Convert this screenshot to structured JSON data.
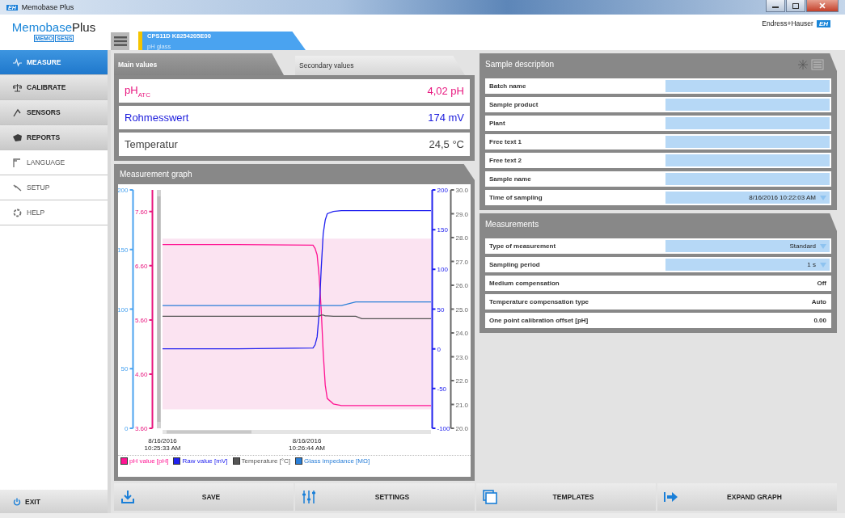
{
  "window": {
    "title": "Memobase Plus",
    "app_icon": "EH"
  },
  "header": {
    "logo_main": "Memobase",
    "logo_accent": "Plus",
    "logo_sub_left": "MEMO",
    "logo_sub_right": "SENS",
    "brand": "Endress+Hauser",
    "brand_mark": "EH",
    "sensor": {
      "name": "CPS11D K8254205E00",
      "type": "pH glass"
    }
  },
  "sidebar": {
    "items": [
      {
        "label": "MEASURE",
        "kind": "primary",
        "selected": true
      },
      {
        "label": "CALIBRATE",
        "kind": "primary",
        "selected": false
      },
      {
        "label": "SENSORS",
        "kind": "primary",
        "selected": false
      },
      {
        "label": "REPORTS",
        "kind": "primary",
        "selected": false
      },
      {
        "label": "LANGUAGE",
        "kind": "secondary",
        "selected": false
      },
      {
        "label": "SETUP",
        "kind": "secondary",
        "selected": false
      },
      {
        "label": "HELP",
        "kind": "secondary",
        "selected": false
      }
    ],
    "exit": "EXIT"
  },
  "tabs": [
    {
      "label": "Main values",
      "selected": true
    },
    {
      "label": "Secondary values",
      "selected": false
    }
  ],
  "main_values": [
    {
      "label": "pH$_{ATC}$",
      "value": "4,02 pH",
      "color": "#e8177f"
    },
    {
      "label": "Rohmesswert",
      "value": "174 mV",
      "color": "#1a1adc"
    },
    {
      "label": "Temperatur",
      "value": "24,5 °C",
      "color": "#444444"
    }
  ],
  "graph": {
    "title": "Measurement graph",
    "axes": [
      {
        "color": "#4aa3f0",
        "ticks": [
          "200",
          "150",
          "100",
          "50",
          "0"
        ]
      },
      {
        "color": "#e8177f",
        "ticks": [
          "7.60",
          "6.60",
          "5.60",
          "4.60",
          "3.60"
        ]
      },
      {
        "color": "#2222ee",
        "ticks": [
          "200",
          "150",
          "100",
          "50",
          "0",
          "-50",
          "-100"
        ]
      },
      {
        "color": "#666666",
        "ticks": [
          "30.0",
          "29.0",
          "28.0",
          "27.0",
          "26.0",
          "25.0",
          "24.0",
          "23.0",
          "22.0",
          "21.0",
          "20.0"
        ]
      }
    ],
    "x_labels": [
      {
        "date": "8/16/2016",
        "time": "10:25:33 AM"
      },
      {
        "date": "8/16/2016",
        "time": "10:26:44 AM"
      }
    ],
    "legend": [
      {
        "name": "pH value [pH]",
        "color": "#ff1493"
      },
      {
        "name": "Raw value [mV]",
        "color": "#2020f0"
      },
      {
        "name": "Temperature [°C]",
        "color": "#555555"
      },
      {
        "name": "Glass impedance [MΩ]",
        "color": "#2a7fd8"
      }
    ]
  },
  "sample_description": {
    "title": "Sample description",
    "rows": [
      {
        "label": "Batch name",
        "kind": "input"
      },
      {
        "label": "Sample product",
        "kind": "input"
      },
      {
        "label": "Plant",
        "kind": "input"
      },
      {
        "label": "Free text 1",
        "kind": "input"
      },
      {
        "label": "Free text 2",
        "kind": "input"
      },
      {
        "label": "Sample name",
        "kind": "input"
      },
      {
        "label": "Time of sampling",
        "kind": "dropdown",
        "value": "8/16/2016 10:22:03 AM"
      }
    ]
  },
  "measurements": {
    "title": "Measurements",
    "rows": [
      {
        "label": "Type of measurement",
        "kind": "dropdown",
        "value": "Standard"
      },
      {
        "label": "Sampling period",
        "kind": "dropdown",
        "value": "1 s"
      },
      {
        "label": "Medium compensation",
        "kind": "readonly",
        "value": "Off"
      },
      {
        "label": "Temperature compensation type",
        "kind": "readonly",
        "value": "Auto"
      },
      {
        "label": "One point calibration offset [pH]",
        "kind": "readonly",
        "value": "0.00"
      }
    ]
  },
  "actions": [
    {
      "label": "SAVE"
    },
    {
      "label": "SETTINGS"
    },
    {
      "label": "TEMPLATES"
    },
    {
      "label": "EXPAND GRAPH"
    }
  ]
}
